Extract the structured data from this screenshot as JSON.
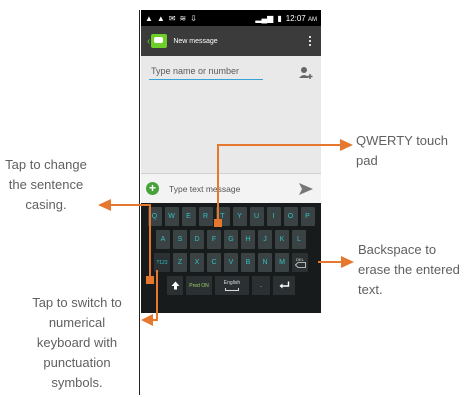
{
  "status_bar": {
    "time": "12:07",
    "ampm": "AM"
  },
  "app": {
    "title": "New message"
  },
  "recipient": {
    "placeholder": "Type name or number"
  },
  "compose": {
    "placeholder": "Type text message"
  },
  "keyboard": {
    "row1": [
      "Q",
      "W",
      "E",
      "R",
      "T",
      "Y",
      "U",
      "I",
      "O",
      "P"
    ],
    "row2": [
      "A",
      "S",
      "D",
      "F",
      "G",
      "H",
      "J",
      "K",
      "L"
    ],
    "row3_mode": "?123",
    "row3": [
      "Z",
      "X",
      "C",
      "V",
      "B",
      "N",
      "M"
    ],
    "del_label": "DEL",
    "pred_label": "Pred ON",
    "space_label": "English",
    "period_label": "."
  },
  "callouts": {
    "casing": "Tap to change the sentence casing.",
    "numeric": "Tap to switch to numerical keyboard with punctuation symbols.",
    "qwerty": "QWERTY touch pad",
    "backspace": "Backspace to erase the entered text."
  },
  "colors": {
    "callout": "#e5782e",
    "key_text": "#31c0c5",
    "accent": "#6ecf2a"
  }
}
